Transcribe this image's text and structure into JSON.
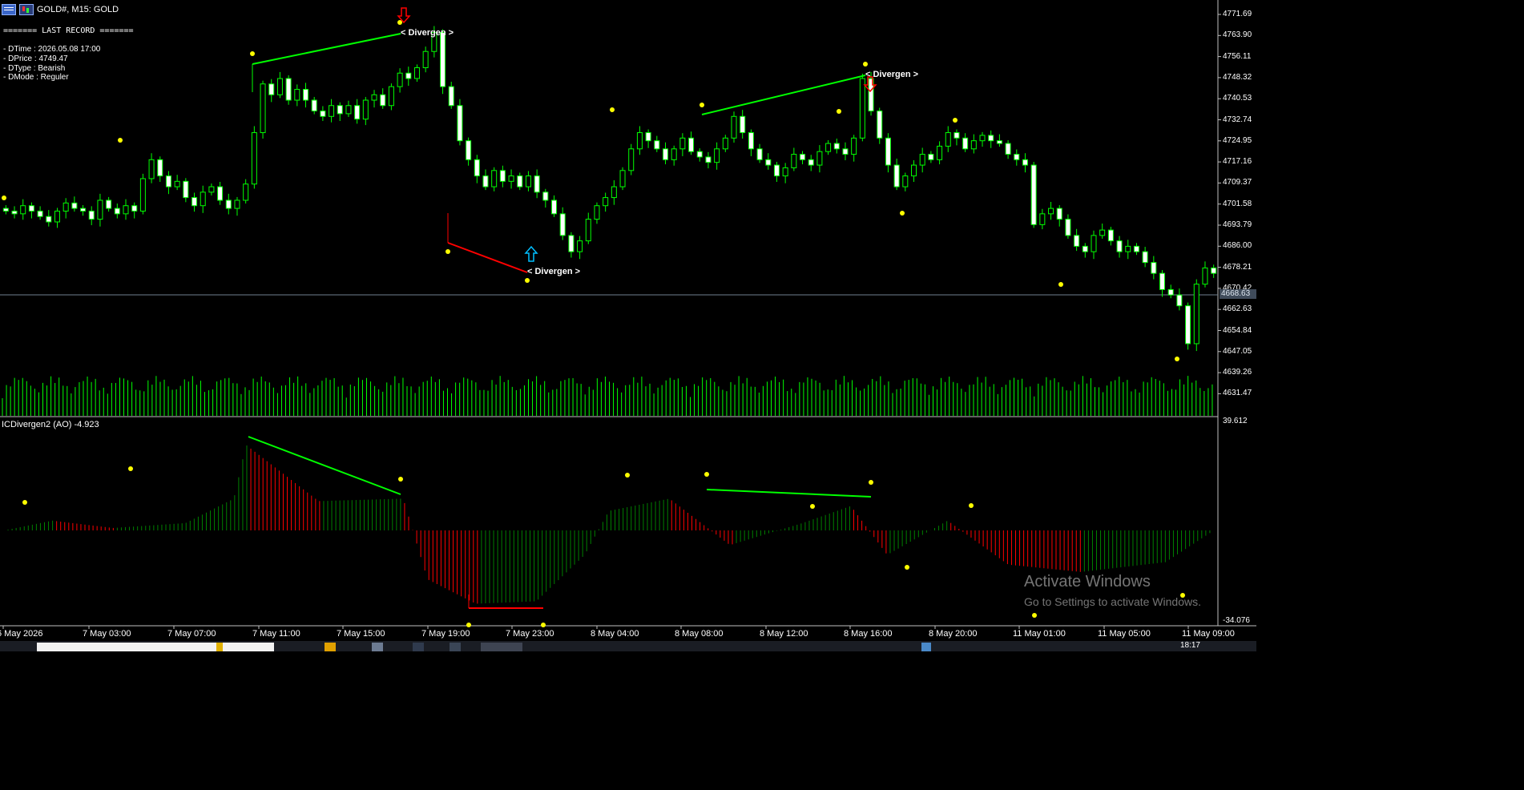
{
  "header": {
    "symbol_title": "GOLD#, M15:  GOLD"
  },
  "record": {
    "heading": "======= LAST RECORD =======",
    "lines": [
      "- DTime : 2026.05.08 17:00",
      "- DPrice : 4749.47",
      "- DType : Bearish",
      "- DMode : Reguler"
    ]
  },
  "divergence_label": "< Divergen >",
  "indicator": {
    "title": "ICDivergen2 (AO) -4.923",
    "max_label": "39.612",
    "min_label": "-34.076"
  },
  "price_axis": [
    "4771.69",
    "4763.90",
    "4756.11",
    "4748.32",
    "4740.53",
    "4732.74",
    "4724.95",
    "4717.16",
    "4709.37",
    "4701.58",
    "4693.79",
    "4686.00",
    "4678.21",
    "4670.42",
    "4662.63",
    "4654.84",
    "4647.05",
    "4639.26",
    "4631.47"
  ],
  "current_price": "4668.63",
  "time_axis": [
    "6 May 2026",
    "7 May 03:00",
    "7 May 07:00",
    "7 May 11:00",
    "7 May 15:00",
    "7 May 19:00",
    "7 May 23:00",
    "8 May 04:00",
    "8 May 08:00",
    "8 May 12:00",
    "8 May 16:00",
    "8 May 20:00",
    "11 May 01:00",
    "11 May 05:00",
    "11 May 09:00"
  ],
  "watermark": {
    "title": "Activate Windows",
    "subtitle": "Go to Settings to activate Windows."
  },
  "taskbar": {
    "clock": "18:17"
  },
  "colors": {
    "candle": "#00ff00",
    "volume": "#00ff00",
    "bull_line": "#00ff00",
    "bear_line": "#ff0000",
    "fractal": "#ffff00",
    "ao_up": "#008000",
    "ao_down": "#ff0000",
    "arrow_down": "#ff0000",
    "arrow_up": "#00bfff"
  },
  "chart_data": {
    "type": "candlestick",
    "symbol": "GOLD#",
    "timeframe": "M15",
    "close_series": [
      4699,
      4698,
      4701,
      4699,
      4697,
      4695,
      4699,
      4702,
      4700,
      4699,
      4696,
      4703,
      4700,
      4698,
      4701,
      4699,
      4711,
      4718,
      4712,
      4708,
      4710,
      4704,
      4701,
      4706,
      4708,
      4703,
      4700,
      4703,
      4709,
      4728,
      4746,
      4742,
      4748,
      4740,
      4744,
      4740,
      4736,
      4734,
      4738,
      4735,
      4738,
      4733,
      4740,
      4742,
      4738,
      4745,
      4750,
      4748,
      4752,
      4758,
      4765,
      4745,
      4738,
      4725,
      4718,
      4712,
      4708,
      4714,
      4710,
      4712,
      4708,
      4712,
      4706,
      4703,
      4698,
      4690,
      4684,
      4688,
      4696,
      4701,
      4704,
      4708,
      4714,
      4722,
      4728,
      4725,
      4722,
      4718,
      4722,
      4726,
      4721,
      4719,
      4717,
      4722,
      4726,
      4734,
      4728,
      4722,
      4718,
      4716,
      4712,
      4715,
      4720,
      4718,
      4716,
      4721,
      4724,
      4722,
      4720,
      4726,
      4748,
      4736,
      4726,
      4716,
      4708,
      4712,
      4716,
      4720,
      4718,
      4723,
      4728,
      4726,
      4722,
      4725,
      4727,
      4725,
      4724,
      4720,
      4718,
      4716,
      4694,
      4698,
      4700,
      4696,
      4690,
      4686,
      4684,
      4690,
      4692,
      4688,
      4684,
      4686,
      4684,
      4680,
      4676,
      4670,
      4668,
      4664,
      4650,
      4672,
      4678,
      4676
    ],
    "fractals_high": [
      4764.5,
      4753.2,
      4736.0
    ],
    "fractals_low": [
      4687.0,
      4676.5,
      4701.0,
      4673.0,
      4649.0
    ],
    "divergences": [
      {
        "type": "Bearish",
        "price": 4764.3
      },
      {
        "type": "Bullish",
        "price": 4676.5
      },
      {
        "type": "Bearish",
        "price": 4749.47
      }
    ]
  }
}
